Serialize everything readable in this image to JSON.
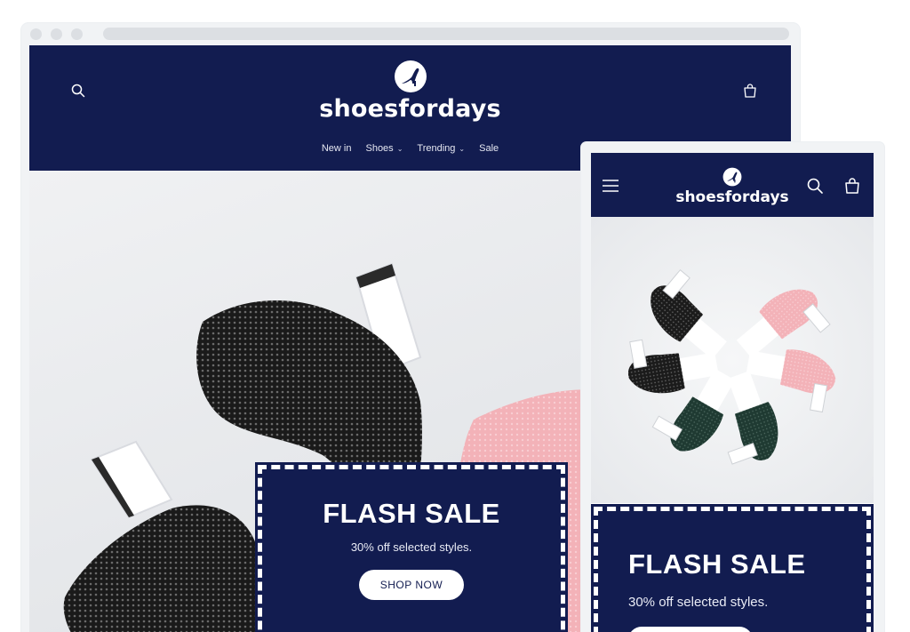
{
  "brand": {
    "name": "shoesfordays",
    "navy": "#121c50",
    "white": "#ffffff",
    "pink": "#f3b2b8"
  },
  "desktop": {
    "nav": [
      {
        "label": "New in",
        "has_dropdown": false
      },
      {
        "label": "Shoes",
        "has_dropdown": true
      },
      {
        "label": "Trending",
        "has_dropdown": true
      },
      {
        "label": "Sale",
        "has_dropdown": false
      }
    ],
    "icons": {
      "search": "search-icon",
      "cart": "cart-icon"
    },
    "sale": {
      "title": "FLASH SALE",
      "subtitle": "30% off selected styles.",
      "button": "SHOP NOW"
    }
  },
  "mobile": {
    "icons": {
      "menu": "hamburger-menu-icon",
      "search": "search-icon",
      "cart": "cart-icon"
    },
    "sale": {
      "title": "FLASH SALE",
      "subtitle": "30% off selected styles."
    }
  }
}
